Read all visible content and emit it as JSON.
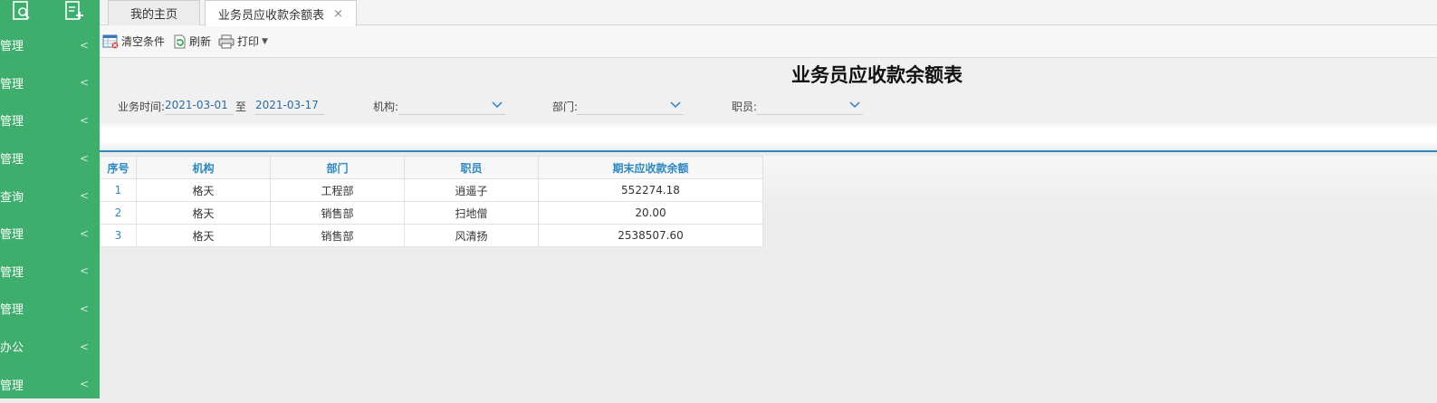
{
  "sidebar": {
    "items": [
      {
        "label": "管理"
      },
      {
        "label": "管理"
      },
      {
        "label": "管理"
      },
      {
        "label": "管理"
      },
      {
        "label": "查询"
      },
      {
        "label": "管理"
      },
      {
        "label": "管理"
      },
      {
        "label": "管理"
      },
      {
        "label": "办公"
      },
      {
        "label": "管理"
      }
    ],
    "chevron": "<"
  },
  "tabs": [
    {
      "label": "我的主页"
    },
    {
      "label": "业务员应收款余额表",
      "close": "×"
    }
  ],
  "toolbar": {
    "clear_label": "清空条件",
    "refresh_label": "刷新",
    "print_label": "打印"
  },
  "report": {
    "title": "业务员应收款余额表",
    "filters": {
      "date_label": "业务时间:",
      "date_from": "2021-03-01",
      "date_to_label": "至",
      "date_to": "2021-03-17",
      "org_label": "机构:",
      "dept_label": "部门:",
      "staff_label": "职员:"
    }
  },
  "table": {
    "columns": [
      "序号",
      "机构",
      "部门",
      "职员",
      "期末应收款余额"
    ],
    "rows": [
      [
        "1",
        "格天",
        "工程部",
        "逍遥子",
        "552274.18"
      ],
      [
        "2",
        "格天",
        "销售部",
        "扫地僧",
        "20.00"
      ],
      [
        "3",
        "格天",
        "销售部",
        "风清扬",
        "2538507.60"
      ]
    ]
  },
  "colors": {
    "sidebar_bg": "#3dae6b",
    "accent": "#2b88c4"
  }
}
